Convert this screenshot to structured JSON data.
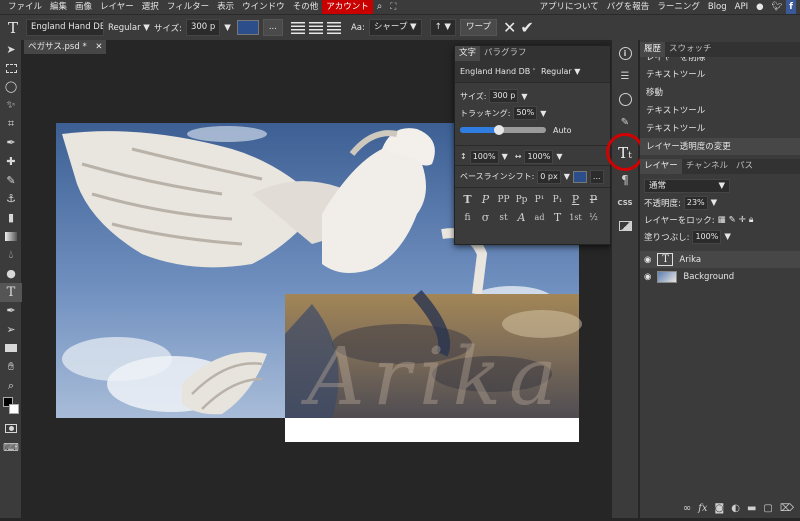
{
  "menubar": {
    "items": [
      "ファイル",
      "編集",
      "画像",
      "レイヤー",
      "選択",
      "フィルター",
      "表示",
      "ウインドウ",
      "その他",
      "アカウント"
    ],
    "active_index": 9,
    "right_items": [
      "アプリについて",
      "バグを報告",
      "ラーニング",
      "Blog",
      "API"
    ]
  },
  "options": {
    "font": "England Hand DB '",
    "style": "Regular",
    "size_label": "サイズ:",
    "size_value": "300 p",
    "more": "...",
    "aa_label": "Aa:",
    "aa_value": "シャープ",
    "warp_button": "ワープ",
    "color": "#2c4f8c"
  },
  "document": {
    "tab_title": "ペガサス.psd *",
    "layer_text": "Arika"
  },
  "character_panel": {
    "tabs": [
      "文字",
      "パラグラフ"
    ],
    "font": "England Hand DB '",
    "style": "Regular",
    "size_label": "サイズ:",
    "size_value": "300 p",
    "tracking_label": "トラッキング:",
    "tracking_value": "50%",
    "leading_value": "Auto",
    "vscale_value": "100%",
    "hscale_value": "100%",
    "baseline_label": "ベースラインシフト:",
    "baseline_value": "0 px",
    "glyphs_row1": [
      "T",
      "P",
      "PP",
      "Pp",
      "P¹",
      "P₁",
      "P",
      "P"
    ],
    "glyphs_row2": [
      "fi",
      "σ",
      "st",
      "A",
      "ad",
      "T",
      "1st",
      "½"
    ]
  },
  "history": {
    "tabs": [
      "履歴",
      "スウォッチ"
    ],
    "items": [
      "レイヤーを削除",
      "テキストツール",
      "移動",
      "テキストツール",
      "テキストツール",
      "レイヤー透明度の変更"
    ]
  },
  "layers": {
    "tabs": [
      "レイヤー",
      "チャンネル",
      "パス"
    ],
    "blend_mode": "通常",
    "opacity_label": "不透明度:",
    "opacity_value": "23%",
    "lock_label": "レイヤーをロック:",
    "fill_label": "塗りつぶし:",
    "fill_value": "100%",
    "items": [
      {
        "name": "Arika",
        "type": "text"
      },
      {
        "name": "Background",
        "type": "image"
      }
    ]
  },
  "colors": {
    "active_menu": "#c80000",
    "annotation_circle": "#d40000",
    "fg": "#000000",
    "bg": "#ffffff"
  }
}
